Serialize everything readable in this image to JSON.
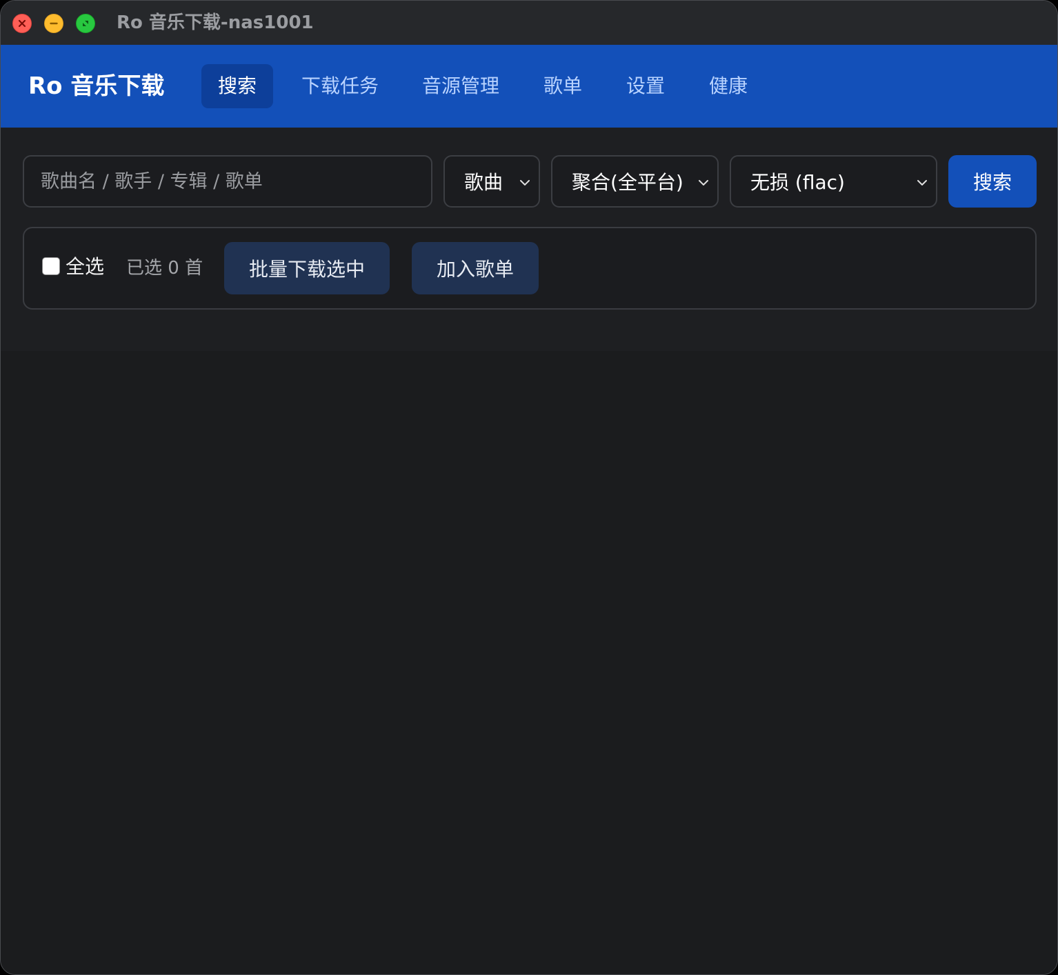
{
  "window": {
    "title": "Ro 音乐下载-nas1001"
  },
  "header": {
    "brand": "Ro 音乐下载",
    "tabs": [
      {
        "label": "搜索",
        "active": true
      },
      {
        "label": "下载任务",
        "active": false
      },
      {
        "label": "音源管理",
        "active": false
      },
      {
        "label": "歌单",
        "active": false
      },
      {
        "label": "设置",
        "active": false
      },
      {
        "label": "健康",
        "active": false
      }
    ]
  },
  "search": {
    "placeholder": "歌曲名 / 歌手 / 专辑 / 歌单",
    "value": "",
    "type_select": "歌曲",
    "platform_select": "聚合(全平台)",
    "quality_select": "无损 (flac)",
    "submit_label": "搜索"
  },
  "toolbar": {
    "select_all_label": "全选",
    "select_all_checked": false,
    "selected_count_text": "已选 0 首",
    "batch_download_label": "批量下载选中",
    "add_to_playlist_label": "加入歌单"
  },
  "colors": {
    "header_bg": "#1350b9",
    "active_tab_bg": "#0d3f9a",
    "primary_button": "#1350b9",
    "secondary_button": "#203252",
    "window_bg": "#1b1c1e"
  },
  "icons": {
    "close": "close-icon",
    "minimize": "minimize-icon",
    "maximize": "fullscreen-icon",
    "dropdown": "chevron-down-icon"
  }
}
